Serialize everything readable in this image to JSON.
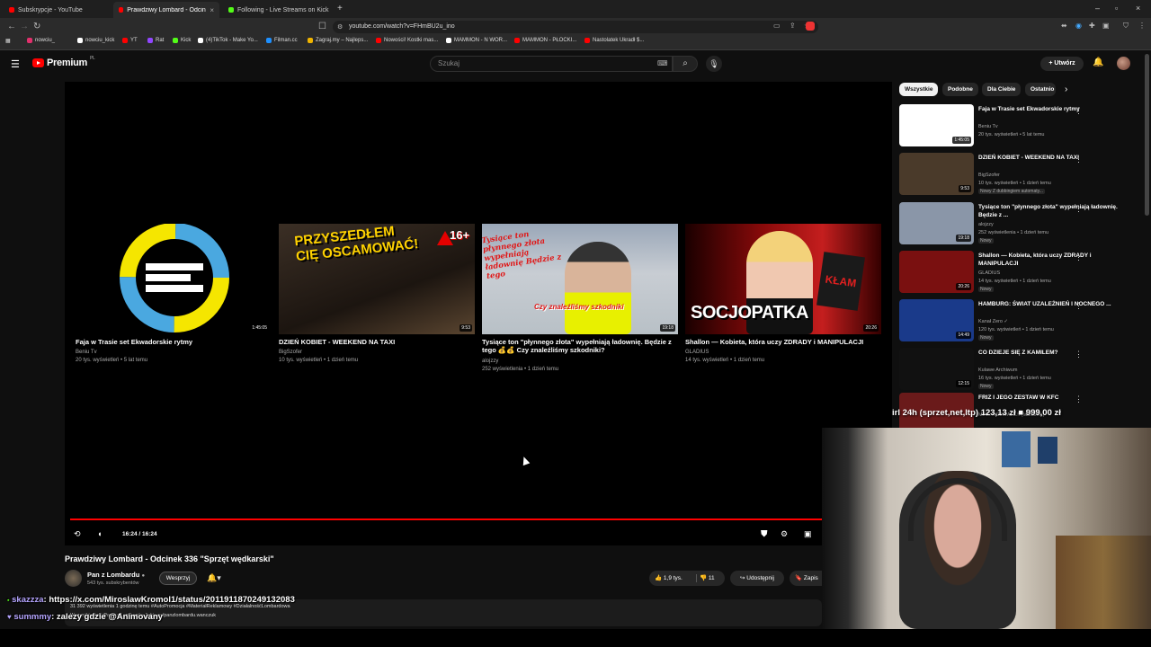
{
  "browser": {
    "tabs": [
      {
        "label": "Subskrypcje - YouTube",
        "color": "#ff0000"
      },
      {
        "label": "Prawdziwy Lombard - Odcinek 3",
        "color": "#ff0000"
      },
      {
        "label": "Following - Live Streams on Kick",
        "color": "#53fc18"
      }
    ],
    "new_tab": "+",
    "url": "youtube.com/watch?v=FHmBU2u_ino",
    "bookmarks": [
      {
        "label": "nowciu_",
        "color": "#e1306c"
      },
      {
        "label": "nowciu_kick",
        "color": "#ffffff"
      },
      {
        "label": "YT",
        "color": "#ff0000"
      },
      {
        "label": "Rat",
        "color": "#9146ff"
      },
      {
        "label": "Kick",
        "color": "#53fc18"
      },
      {
        "label": "(4)TikTok - Make Yo...",
        "color": "#ffffff"
      },
      {
        "label": "Filman.cc",
        "color": "#1e90ff"
      },
      {
        "label": "Zagraj.my – Najleps...",
        "color": "#f0b400"
      },
      {
        "label": "Nowości! Kostki mas...",
        "color": "#ff0000"
      },
      {
        "label": "MAMMON - N WOR...",
        "color": "#ffffff"
      },
      {
        "label": "MAMMON - PŁOCKI...",
        "color": "#ff0000"
      },
      {
        "label": "Nastolatek Ukradł $...",
        "color": "#ff0000"
      }
    ]
  },
  "youtube": {
    "logo": "Premium",
    "logo_region": "PL",
    "search_placeholder": "Szukaj",
    "create_label": "+ Utwórz"
  },
  "end_cards": [
    {
      "title": "Faja w Trasie set Ekwadorskie rytmy",
      "channel": "Beniu Tv",
      "meta": "20 tys. wyświetleń • 5 lat temu",
      "duration": "1:45:05"
    },
    {
      "title": "DZIEŃ KOBIET - WEEKEND NA TAXI",
      "channel": "BigSzofer",
      "meta": "10 tys. wyświetleń • 1 dzień temu",
      "duration": "9:53"
    },
    {
      "title": "Tysiące ton \"płynnego złota\" wypełniają ładownię. Będzie z tego 💰💰 Czy znaleźliśmy szkodniki?",
      "channel": "alojzzy",
      "meta": "252 wyświetlenia • 1 dzień temu",
      "duration": "19:18"
    },
    {
      "title": "Shallon — Kobieta, która uczy ZDRADY i MANIPULACJI",
      "channel": "GLADIUS",
      "meta": "14 tys. wyświetleń • 1 dzień temu",
      "duration": "20:26"
    }
  ],
  "thumb_text": {
    "card2": "PRZYSZEDŁEM CIĘ OSCAMOWAĆ!",
    "card2_badge": "16+",
    "card3": "Tysiące ton płynnego złota wypełniają ładownię Będzie z tego",
    "card3_sub": "Czy znaleźliśmy szkodniki",
    "card4": "SOCJOPATKA",
    "card4_badge": "KŁAM"
  },
  "player": {
    "time": "16:24 / 16:24",
    "progress_fraction": 1.0
  },
  "video": {
    "title": "Prawdziwy Lombard - Odcinek 336 \"Sprzęt wędkarski\"",
    "channel": "Pan z Lombardu",
    "subscribers": "543 tys. subskrybentów",
    "support_label": "Wesprzyj",
    "likes": "1,9 tys.",
    "dislikes": "11",
    "share_label": "Udostępnij",
    "save_label": "Zapis",
    "desc_line1": "31 392 wyświetlenia  1 godzinę temu  #AutoPromocja #MateriałReklamowy #DziałalnośćLombardowa",
    "desc_line2": "Wszystkie linki Pana z Lombardu: linktr.ee/panzlombardu.wanczuk"
  },
  "chat": [
    {
      "user": "skazzza",
      "message": ": https://x.com/MiroslawKromol1/status/2011911870249132083"
    },
    {
      "user": "summmy",
      "message": ": zalezy gdzie @Animovany"
    }
  ],
  "sidebar": {
    "chips": [
      "Wszystkie",
      "Podobne",
      "Dla Ciebie",
      "Ostatnio"
    ],
    "videos": [
      {
        "title": "Faja w Trasie set Ekwadorskie rytmy",
        "channel": "Beniu Tv",
        "meta": "20 tys. wyświetleń • 5 lat temu",
        "badge": "",
        "duration": "1:45:05",
        "bg": "#ffffff"
      },
      {
        "title": "DZIEŃ KOBIET - WEEKEND NA TAXI",
        "channel": "BigSzofer",
        "meta": "10 tys. wyświetleń • 1 dzień temu",
        "badge": "Nowy   Z dubbingiem automaty...",
        "duration": "9:53",
        "bg": "#4a3a2a"
      },
      {
        "title": "Tysiące ton \"płynnego złota\" wypełniają ładownię. Będzie z ...",
        "channel": "alojzzy",
        "meta": "252 wyświetlenia • 1 dzień temu",
        "badge": "Nowy",
        "duration": "19:18",
        "bg": "#8a96a8"
      },
      {
        "title": "Shallon — Kobieta, która uczy ZDRADY i MANIPULACJI",
        "channel": "GLADIUS",
        "meta": "14 tys. wyświetleń • 1 dzień temu",
        "badge": "Nowy",
        "duration": "20:26",
        "bg": "#7a1010"
      },
      {
        "title": "HAMBURG: ŚWIAT UZALEŻNIEŃ I NOCNEGO ...",
        "channel": "Kanał Zero ✓",
        "meta": "120 tys. wyświetleń • 1 dzień temu",
        "badge": "Nowy",
        "duration": "14:49",
        "bg": "#1a3a8a"
      },
      {
        "title": "CO DZIEJE SIĘ Z KAMILEM?",
        "channel": "Kulawe Archiwum",
        "meta": "16 tys. wyświetleń • 1 dzień temu",
        "badge": "Nowy",
        "duration": "12:15",
        "bg": "#111111"
      },
      {
        "title": "FRIZ I JEGO ZESTAW W KFC",
        "channel": "MINE ROZWALIŁ!! (MafiaIRL)",
        "meta": "",
        "badge": "",
        "duration": "",
        "bg": "#6a1a1a"
      }
    ]
  },
  "stream_overlay": {
    "text": "irl 24h (sprzet,net,ltp)   123,13 zł  ■  999,00 zł"
  },
  "colors": {
    "accent": "#ff0000",
    "background": "#0f0f0f",
    "surface": "#272727"
  }
}
